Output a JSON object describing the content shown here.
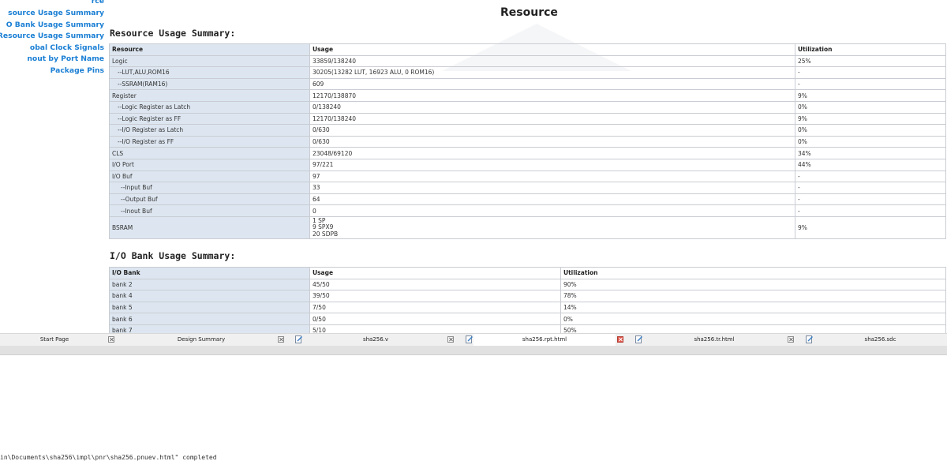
{
  "sidebar": {
    "items": [
      {
        "label": "rce"
      },
      {
        "label": "source Usage Summary"
      },
      {
        "label": "O Bank Usage Summary"
      },
      {
        "label": "ock Resource Usage Summary"
      },
      {
        "label": "obal Clock Signals"
      },
      {
        "label": "nout by Port Name"
      },
      {
        "label": "Package Pins"
      }
    ]
  },
  "report": {
    "title": "Resource"
  },
  "resource_section": {
    "heading": "Resource Usage Summary:",
    "columns": [
      "Resource",
      "Usage",
      "Utilization"
    ],
    "rows": [
      {
        "resource": "Logic",
        "usage": "33859/138240",
        "utilization": "25%"
      },
      {
        "resource": "--LUT,ALU,ROM16",
        "usage": "30205(13282 LUT, 16923 ALU, 0 ROM16)",
        "utilization": "-"
      },
      {
        "resource": "--SSRAM(RAM16)",
        "usage": "609",
        "utilization": "-"
      },
      {
        "resource": "Register",
        "usage": "12170/138870",
        "utilization": "9%"
      },
      {
        "resource": "--Logic Register as Latch",
        "usage": "0/138240",
        "utilization": "0%"
      },
      {
        "resource": "--Logic Register as FF",
        "usage": "12170/138240",
        "utilization": "9%"
      },
      {
        "resource": "--I/O Register as Latch",
        "usage": "0/630",
        "utilization": "0%"
      },
      {
        "resource": "--I/O Register as FF",
        "usage": "0/630",
        "utilization": "0%"
      },
      {
        "resource": "CLS",
        "usage": "23048/69120",
        "utilization": "34%"
      },
      {
        "resource": "I/O Port",
        "usage": "97/221",
        "utilization": "44%"
      },
      {
        "resource": "I/O Buf",
        "usage": "97",
        "utilization": "-"
      },
      {
        "resource": "--Input Buf",
        "usage": "33",
        "utilization": "-"
      },
      {
        "resource": "--Output Buf",
        "usage": "64",
        "utilization": "-"
      },
      {
        "resource": "--Inout Buf",
        "usage": "0",
        "utilization": "-"
      }
    ],
    "bsram": {
      "resource": "BSRAM",
      "usage_lines": [
        "1 SP",
        "9 SPX9",
        "20 SDPB"
      ],
      "utilization": "9%"
    }
  },
  "iobank_section": {
    "heading": "I/O Bank Usage Summary:",
    "columns": [
      "I/O Bank",
      "Usage",
      "Utilization"
    ],
    "rows": [
      {
        "bank": "bank 2",
        "usage": "45/50",
        "utilization": "90%"
      },
      {
        "bank": "bank 4",
        "usage": "39/50",
        "utilization": "78%"
      },
      {
        "bank": "bank 5",
        "usage": "7/50",
        "utilization": "14%"
      },
      {
        "bank": "bank 6",
        "usage": "0/50",
        "utilization": "0%"
      },
      {
        "bank": "bank 7",
        "usage": "5/10",
        "utilization": "50%"
      }
    ]
  },
  "tabs": [
    {
      "label": "Start Page"
    },
    {
      "label": "Design Summary"
    },
    {
      "label": "sha256.v"
    },
    {
      "label": "sha256.rpt.html",
      "active": true
    },
    {
      "label": "sha256.tr.html"
    },
    {
      "label": "sha256.sdc"
    }
  ],
  "console": {
    "line": "in\\Documents\\sha256\\impl\\pnr\\sha256.pnuev.html\" completed"
  },
  "colors": {
    "link": "#1a7fd4",
    "key_cell_bg": "#dde6f0",
    "active_close": "#e2574c"
  }
}
